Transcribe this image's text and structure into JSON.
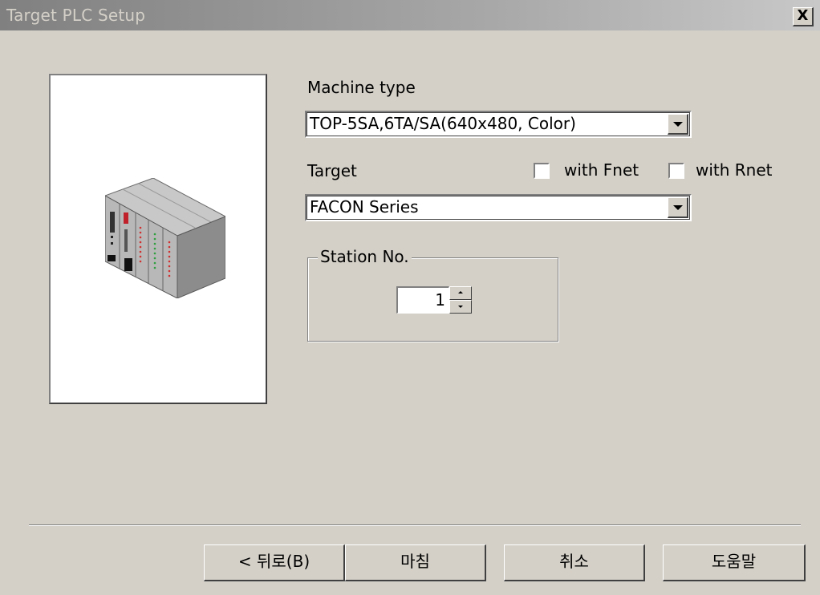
{
  "window": {
    "title": "Target PLC Setup",
    "close_label": "X"
  },
  "machine_type": {
    "label": "Machine type",
    "selected": "TOP-5SA,6TA/SA(640x480, Color)"
  },
  "target": {
    "label": "Target",
    "selected": "FACON Series",
    "with_fnet": {
      "label": "with Fnet",
      "checked": false
    },
    "with_rnet": {
      "label": "with Rnet",
      "checked": false
    }
  },
  "station": {
    "legend": "Station No.",
    "value": "1"
  },
  "buttons": {
    "back": "< 뒤로(B)",
    "finish": "마침",
    "cancel": "취소",
    "help": "도움말"
  },
  "icons": {
    "plc": "plc-rack-icon",
    "close": "close-icon",
    "dropdown": "chevron-down-icon"
  }
}
